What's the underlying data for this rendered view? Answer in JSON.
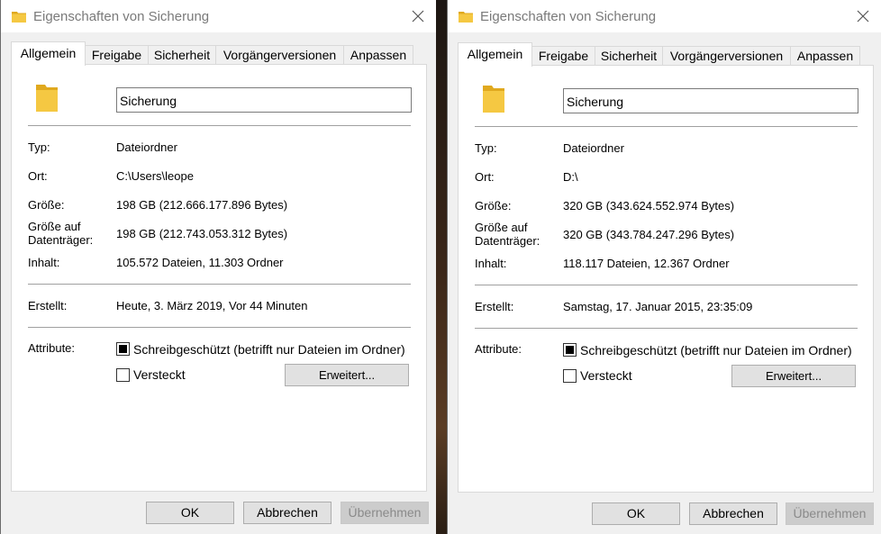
{
  "colors": {
    "folder": "#f5c842",
    "folder_dark": "#e0a91e",
    "disabled_text": "#8a8a8a"
  },
  "left": {
    "title": "Eigenschaften von Sicherung",
    "tabs": [
      "Allgemein",
      "Freigabe",
      "Sicherheit",
      "Vorgängerversionen",
      "Anpassen"
    ],
    "folder_name": "Sicherung",
    "labels": {
      "type": "Typ:",
      "location": "Ort:",
      "size": "Größe:",
      "size_on_disk_1": "Größe auf",
      "size_on_disk_2": "Datenträger:",
      "contents": "Inhalt:",
      "created": "Erstellt:",
      "attributes": "Attribute:"
    },
    "values": {
      "type": "Dateiordner",
      "location": "C:\\Users\\leope",
      "size": "198 GB (212.666.177.896 Bytes)",
      "size_on_disk": "198 GB (212.743.053.312 Bytes)",
      "contents": "105.572 Dateien, 11.303 Ordner",
      "created": "Heute, 3. März 2019, Vor 44 Minuten"
    },
    "attributes": {
      "readonly_label": "Schreibgeschützt (betrifft nur Dateien im Ordner)",
      "readonly_state": "indeterminate",
      "hidden_label": "Versteckt",
      "hidden_state": "unchecked",
      "advanced_button": "Erweitert..."
    },
    "buttons": {
      "ok": "OK",
      "cancel": "Abbrechen",
      "apply": "Übernehmen"
    },
    "apply_enabled": false
  },
  "right": {
    "title": "Eigenschaften von Sicherung",
    "tabs": [
      "Allgemein",
      "Freigabe",
      "Sicherheit",
      "Vorgängerversionen",
      "Anpassen"
    ],
    "folder_name": "Sicherung",
    "labels": {
      "type": "Typ:",
      "location": "Ort:",
      "size": "Größe:",
      "size_on_disk_1": "Größe auf",
      "size_on_disk_2": "Datenträger:",
      "contents": "Inhalt:",
      "created": "Erstellt:",
      "attributes": "Attribute:"
    },
    "values": {
      "type": "Dateiordner",
      "location": "D:\\",
      "size": "320 GB (343.624.552.974 Bytes)",
      "size_on_disk": "320 GB (343.784.247.296 Bytes)",
      "contents": "118.117 Dateien, 12.367 Ordner",
      "created": "Samstag, 17. Januar 2015, 23:35:09"
    },
    "attributes": {
      "readonly_label": "Schreibgeschützt (betrifft nur Dateien im Ordner)",
      "readonly_state": "indeterminate",
      "hidden_label": "Versteckt",
      "hidden_state": "unchecked",
      "advanced_button": "Erweitert..."
    },
    "buttons": {
      "ok": "OK",
      "cancel": "Abbrechen",
      "apply": "Übernehmen"
    },
    "apply_enabled": false
  }
}
